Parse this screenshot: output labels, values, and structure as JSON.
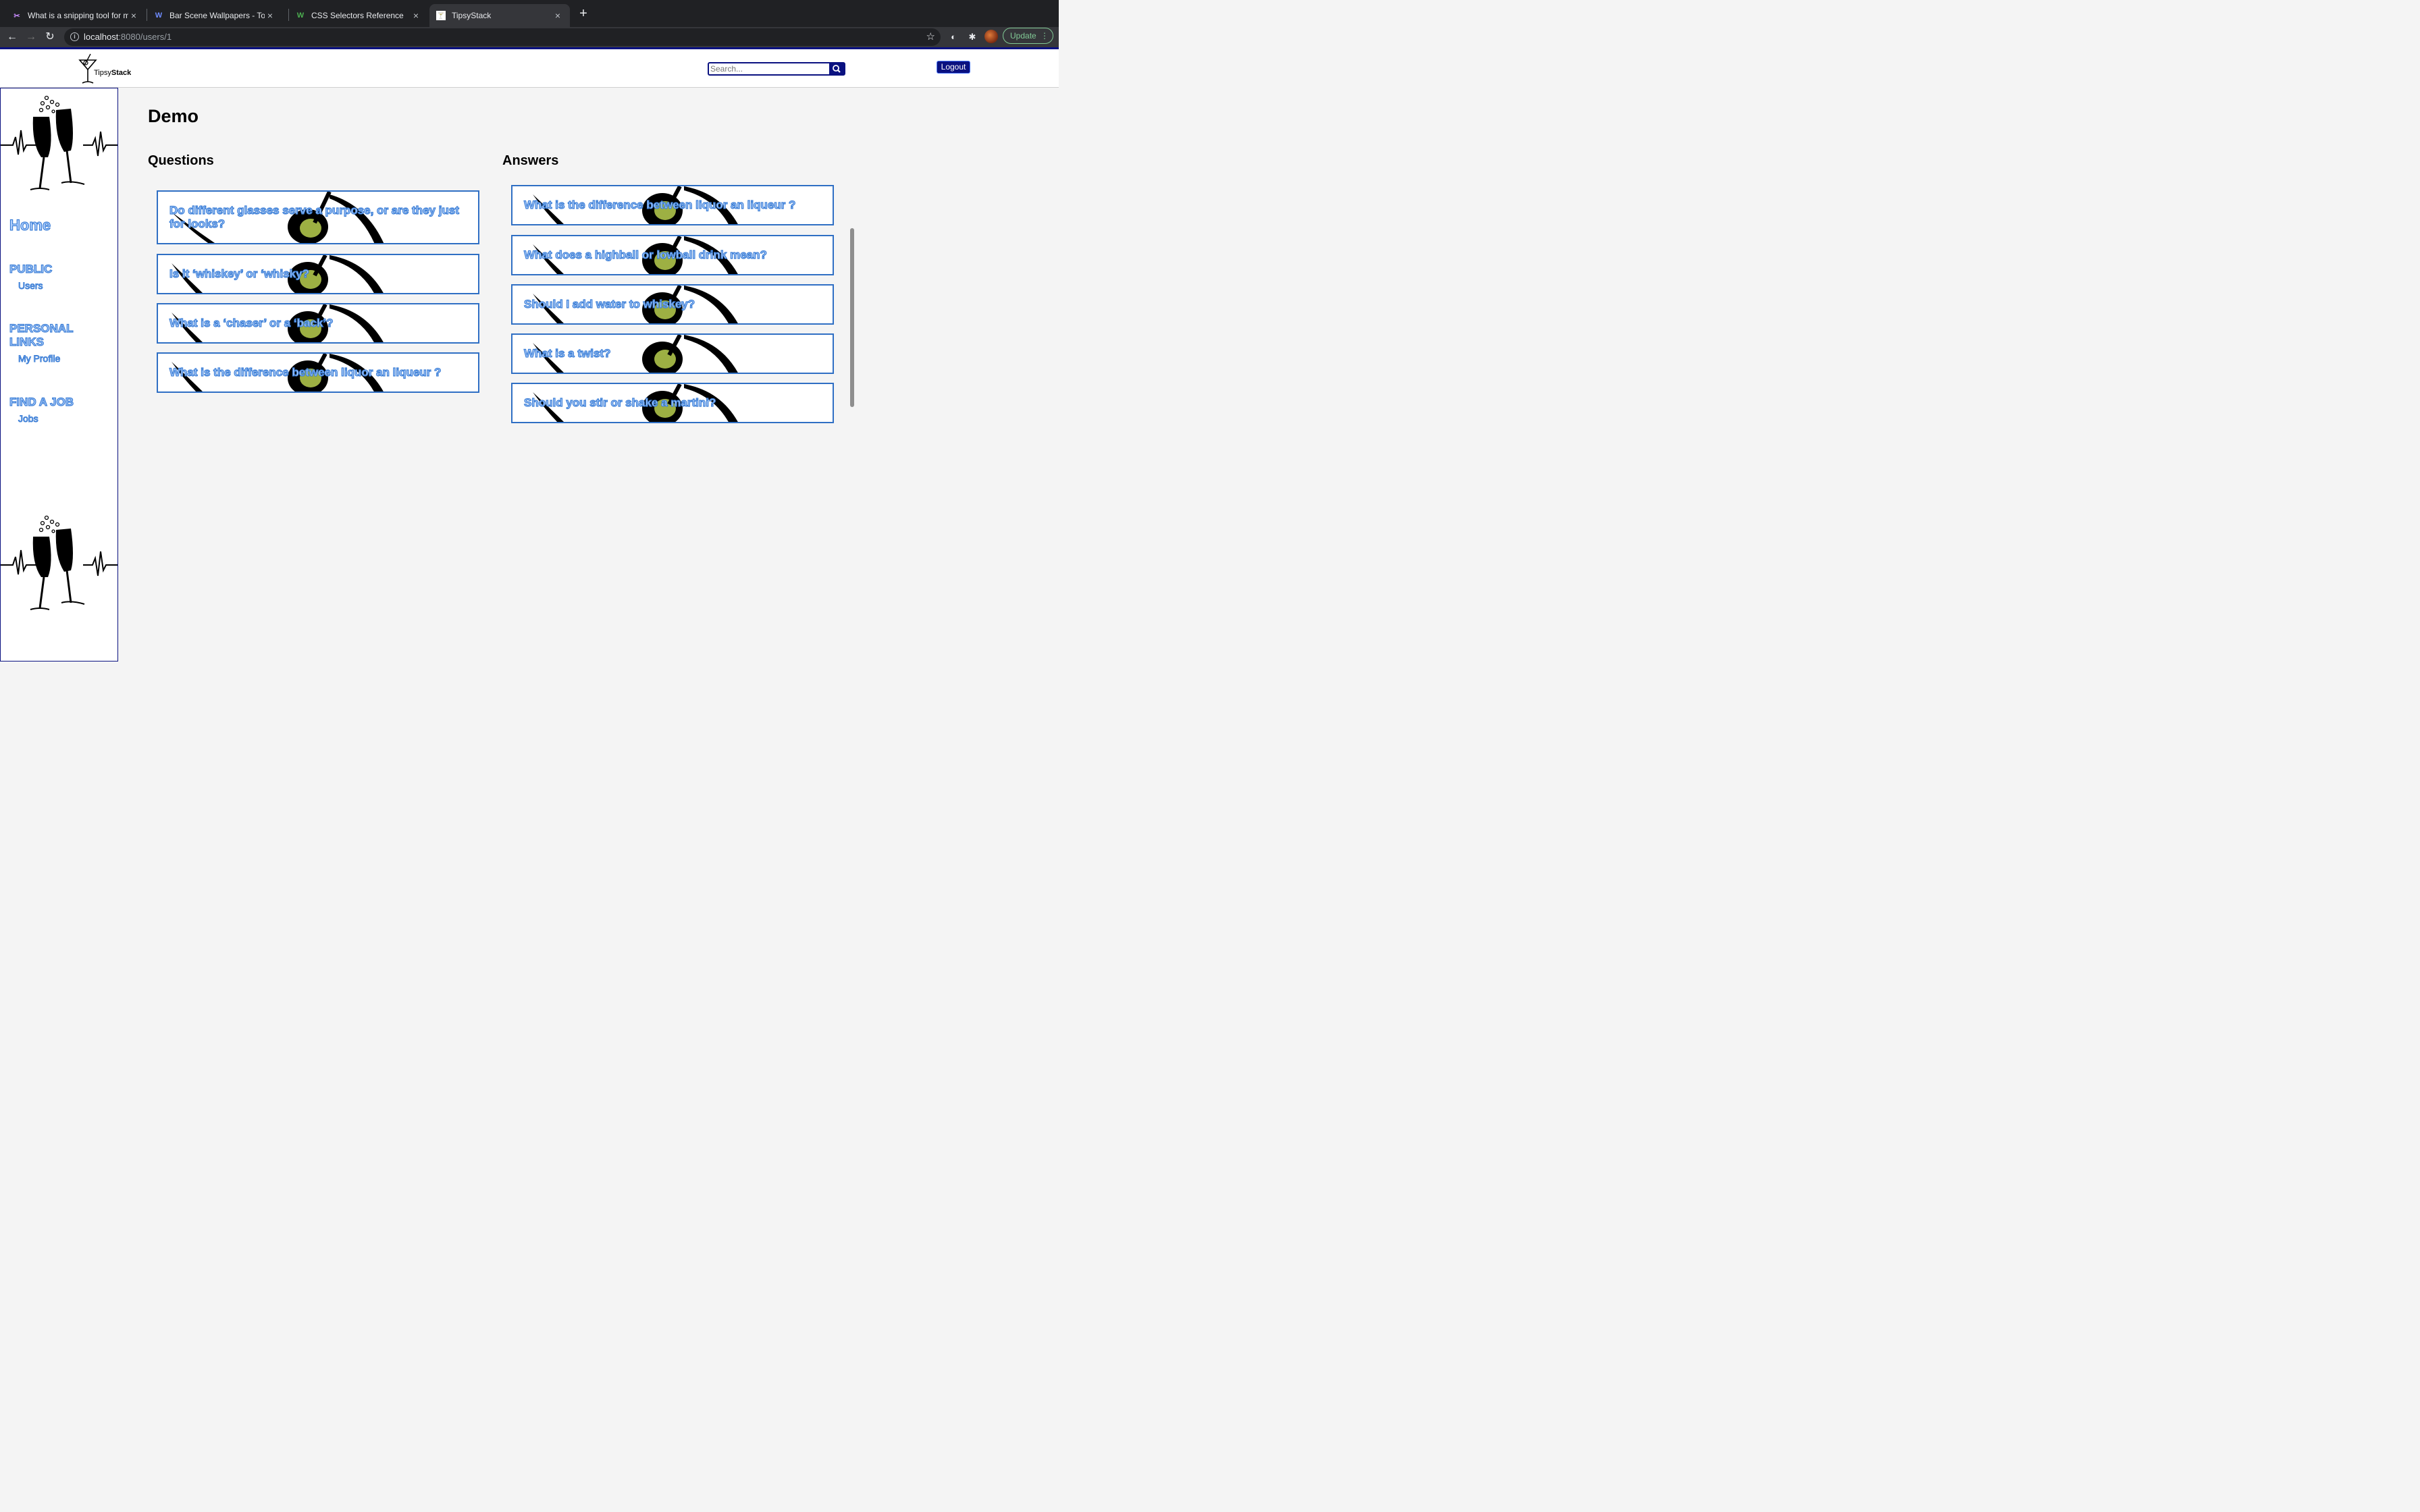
{
  "browser": {
    "tabs": [
      {
        "title": "What is a snipping tool for mac",
        "icon": "snip-favicon-icon",
        "active": false
      },
      {
        "title": "Bar Scene Wallpapers - Top Fre",
        "icon": "wallpaper-favicon-icon",
        "active": false
      },
      {
        "title": "CSS Selectors Reference",
        "icon": "w3-favicon-icon",
        "active": false
      },
      {
        "title": "TipsyStack",
        "icon": "tipsystack-favicon-icon",
        "active": true
      }
    ],
    "url_host": "localhost",
    "url_rest": ":8080/users/1",
    "update_label": "Update"
  },
  "header": {
    "logo_text_light": "Tipsy",
    "logo_text_bold": "Stack",
    "search_placeholder": "Search...",
    "logout_label": "Logout"
  },
  "sidebar": {
    "home": "Home",
    "public_heading": "PUBLIC",
    "users_link": "Users",
    "personal_heading_line1": "PERSONAL",
    "personal_heading_line2": "LINKS",
    "profile_link": "My Profile",
    "job_heading": "FIND A JOB",
    "jobs_link": "Jobs"
  },
  "main": {
    "title": "Demo",
    "questions_heading": "Questions",
    "answers_heading": "Answers",
    "questions": [
      "Do different glasses serve a purpose, or are they just for looks?",
      "Is it ‘whiskey’ or ‘whisky?",
      "What is a ‘chaser’ or a ‘back’?",
      "What is the difference between liquor an liqueur ?"
    ],
    "answers": [
      "What is the difference between liquor an liqueur ?",
      "What does a highball or lowball drink mean?",
      "Should I add water to whiskey?",
      "What is a twist?",
      "Should you stir or shake a martini?"
    ]
  },
  "colors": {
    "brand_navy": "#0a1180",
    "card_border": "#2f6fc4",
    "link_fill": "#b5d3ff",
    "link_stroke": "#3d7fd6",
    "olive_green": "#9db043"
  }
}
